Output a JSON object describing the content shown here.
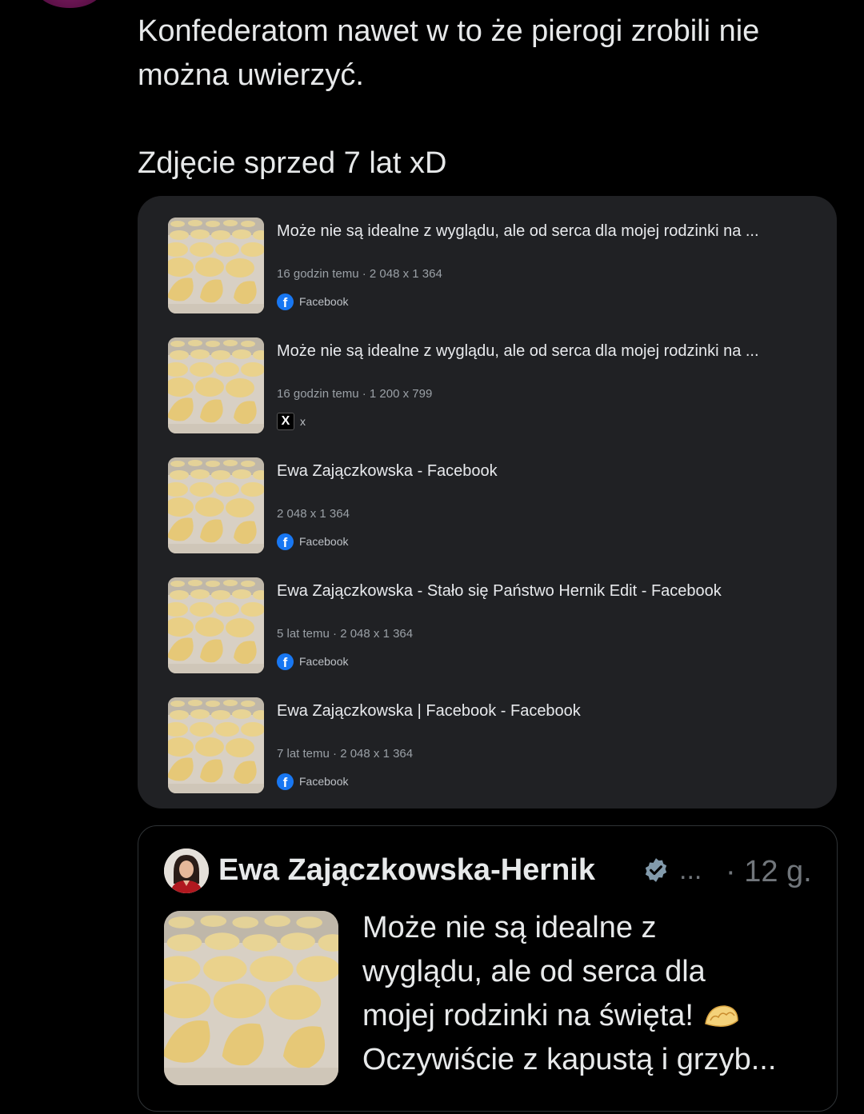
{
  "tweet": {
    "lines": [
      "Konfederatom nawet w to że pierogi zrobili nie",
      "można uwierzyć.",
      "Zdjęcie sprzed 7 lat xD"
    ]
  },
  "search_results": [
    {
      "title": "Może nie są idealne z wyglądu, ale od serca dla mojej rodzinki na ...",
      "meta": "16 godzin temu · 2 048 x 1 364",
      "source": "Facebook",
      "source_icon": "facebook-icon"
    },
    {
      "title": "Może nie są idealne z wyglądu, ale od serca dla mojej rodzinki na ...",
      "meta": "16 godzin temu · 1 200 x 799",
      "source": "x",
      "source_icon": "x-logo-icon"
    },
    {
      "title": "Ewa Zajączkowska - Facebook",
      "meta": "2 048 x 1 364",
      "source": "Facebook",
      "source_icon": "facebook-icon"
    },
    {
      "title": "Ewa Zajączkowska - Stało się Państwo Hernik Edit - Facebook",
      "meta": "5 lat temu · 2 048 x 1 364",
      "source": "Facebook",
      "source_icon": "facebook-icon"
    },
    {
      "title": "Ewa Zajączkowska | Facebook - Facebook",
      "meta": "7 lat temu · 2 048 x 1 364",
      "source": "Facebook",
      "source_icon": "facebook-icon"
    }
  ],
  "quote": {
    "author_name": "Ewa Zajączkowska-Hernik",
    "ellipsis": "...",
    "time": "· 12 g.",
    "text_lines": [
      "Może nie są idealne z",
      "wyglądu, ale od serca dla",
      "mojej rodzinki na święta!",
      "Oczywiście z kapustą i grzyb..."
    ],
    "emoji": "dumpling-emoji"
  },
  "icons": {
    "facebook": "f",
    "x": "X"
  },
  "colors": {
    "background": "#000000",
    "card": "#202124",
    "facebook_blue": "#1877f2",
    "verified": "#829aab",
    "muted": "#71767b"
  }
}
